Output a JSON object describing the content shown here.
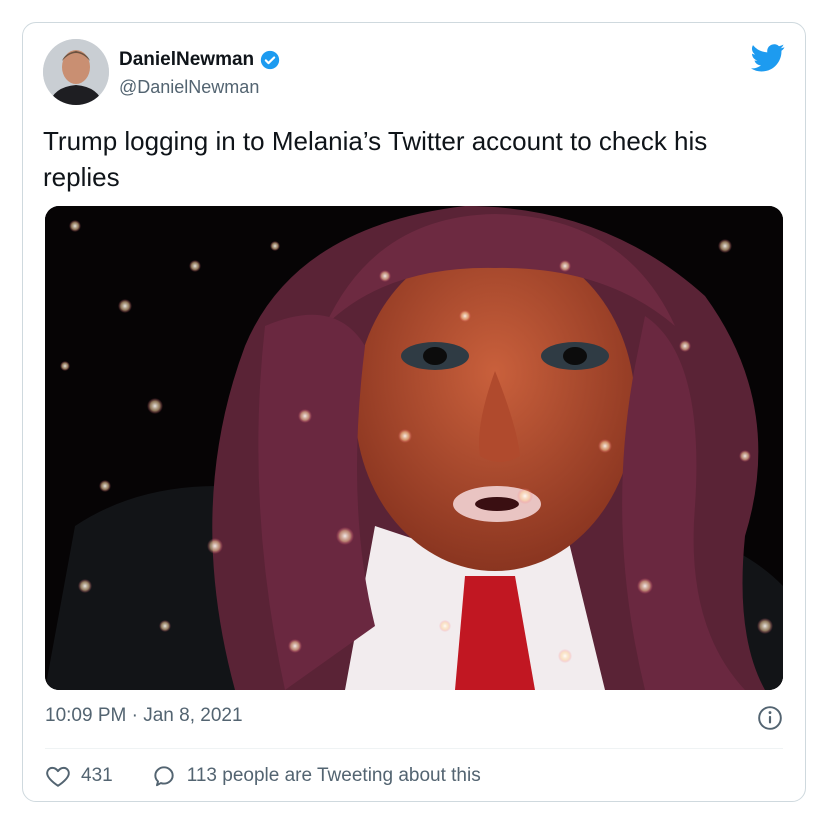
{
  "author": {
    "display_name": "DanielNewman",
    "handle": "@DanielNewman",
    "verified": true
  },
  "tweet": {
    "text": "Trump logging in to Melania’s Twitter account to check his replies",
    "timestamp": "10:09 PM · Jan 8, 2021"
  },
  "actions": {
    "like_count": "431",
    "reply_label": "113 people are Tweeting about this"
  },
  "colors": {
    "brand": "#1d9bf0",
    "secondary_text": "#536471",
    "border": "#cfd9de"
  },
  "icons": {
    "logo": "twitter-bird-icon",
    "verified": "verified-badge-icon",
    "info": "info-icon",
    "like": "heart-icon",
    "reply": "speech-bubble-icon"
  }
}
